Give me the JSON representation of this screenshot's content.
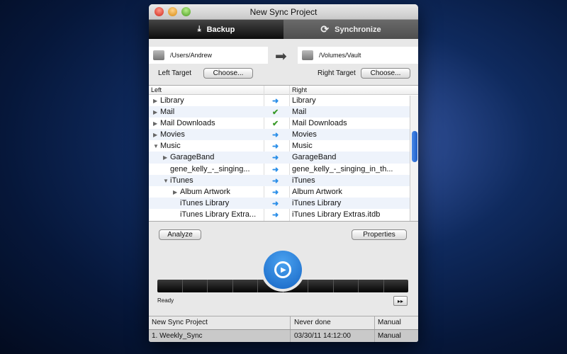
{
  "window": {
    "title": "New Sync Project"
  },
  "tabs": [
    {
      "label": "Backup",
      "icon": "download-icon"
    },
    {
      "label": "Synchronize",
      "icon": "sync-icon"
    }
  ],
  "left_path": "/Users/Andrew",
  "right_path": "/Volumes/Vault",
  "left_target_label": "Left Target",
  "right_target_label": "Right Target",
  "choose_label": "Choose...",
  "table": {
    "headers": {
      "left": "Left",
      "right": "Right"
    },
    "rows": [
      {
        "left": "Library",
        "right": "Library",
        "level": 0,
        "tri": "▶",
        "action": "arrow"
      },
      {
        "left": "Mail",
        "right": "Mail",
        "level": 0,
        "tri": "▶",
        "action": "check"
      },
      {
        "left": "Mail Downloads",
        "right": "Mail Downloads",
        "level": 0,
        "tri": "▶",
        "action": "check"
      },
      {
        "left": "Movies",
        "right": "Movies",
        "level": 0,
        "tri": "▶",
        "action": "arrow"
      },
      {
        "left": "Music",
        "right": "Music",
        "level": 0,
        "tri": "▼",
        "action": "arrow"
      },
      {
        "left": "GarageBand",
        "right": "GarageBand",
        "level": 1,
        "tri": "▶",
        "action": "arrow"
      },
      {
        "left": "gene_kelly_-_singing...",
        "right": "gene_kelly_-_singing_in_th...",
        "level": 1,
        "tri": "",
        "action": "arrow"
      },
      {
        "left": "iTunes",
        "right": "iTunes",
        "level": 1,
        "tri": "▼",
        "action": "arrow"
      },
      {
        "left": "Album Artwork",
        "right": "Album Artwork",
        "level": 2,
        "tri": "▶",
        "action": "arrow"
      },
      {
        "left": "iTunes Library",
        "right": "iTunes Library",
        "level": 2,
        "tri": "",
        "action": "arrow"
      },
      {
        "left": "iTunes Library Extra...",
        "right": "iTunes Library Extras.itdb",
        "level": 2,
        "tri": "",
        "action": "arrow"
      }
    ]
  },
  "analyze_label": "Analyze",
  "properties_label": "Properties",
  "status": "Ready",
  "skip_label": "▸▸",
  "projects": [
    {
      "name": "New Sync Project",
      "last": "Never done",
      "mode": "Manual"
    },
    {
      "name": "1. Weekly_Sync",
      "last": "03/30/11 14:12:00",
      "mode": "Manual"
    }
  ]
}
